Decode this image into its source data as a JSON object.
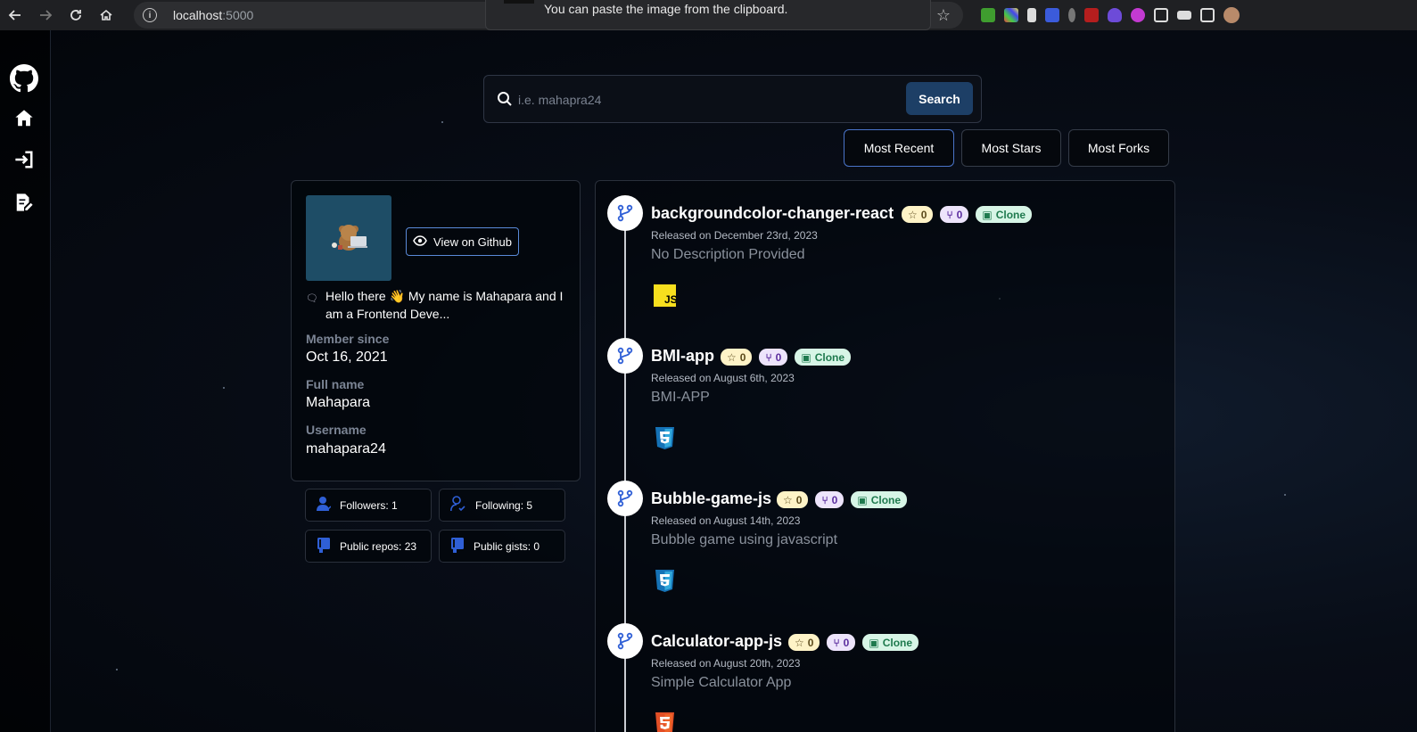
{
  "browser": {
    "url_host": "localhost",
    "url_port": ":5000",
    "toast_message": "You can paste the image from the clipboard."
  },
  "search": {
    "placeholder": "i.e. mahapra24",
    "button_label": "Search"
  },
  "sort": {
    "options": [
      "Most Recent",
      "Most Stars",
      "Most Forks"
    ],
    "active": "Most Recent"
  },
  "profile": {
    "view_github_label": "View on Github",
    "bio": "Hello there 👋 My name is Mahapara and I am a Frontend Deve...",
    "member_since_label": "Member since",
    "member_since": "Oct 16, 2021",
    "full_name_label": "Full name",
    "full_name": "Mahapara",
    "username_label": "Username",
    "username": "mahapara24"
  },
  "stats": {
    "followers": "Followers: 1",
    "following": "Following: 5",
    "public_repos": "Public repos: 23",
    "public_gists": "Public gists: 0"
  },
  "repos": [
    {
      "name": "backgroundcolor-changer-react",
      "stars": "0",
      "forks": "0",
      "clone_label": "Clone",
      "released": "Released on December 23rd, 2023",
      "description": "No Description Provided",
      "language": "js-icon"
    },
    {
      "name": "BMI-app",
      "stars": "0",
      "forks": "0",
      "clone_label": "Clone",
      "released": "Released on August 6th, 2023",
      "description": "BMI-APP",
      "language": "css3-icon"
    },
    {
      "name": "Bubble-game-js",
      "stars": "0",
      "forks": "0",
      "clone_label": "Clone",
      "released": "Released on August 14th, 2023",
      "description": "Bubble game using javascript",
      "language": "css3-icon"
    },
    {
      "name": "Calculator-app-js",
      "stars": "0",
      "forks": "0",
      "clone_label": "Clone",
      "released": "Released on August 20th, 2023",
      "description": "Simple Calculator App",
      "language": "html5-icon"
    }
  ],
  "colors": {
    "accent": "#4a74c9",
    "search_button": "#1d3f66"
  }
}
